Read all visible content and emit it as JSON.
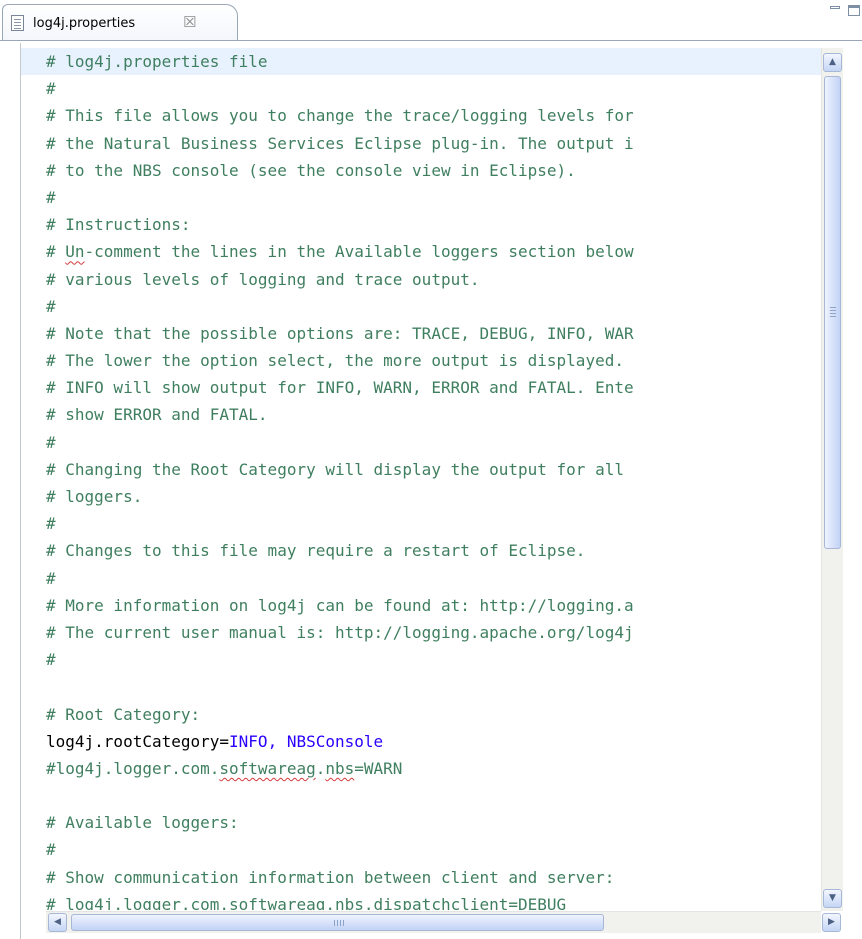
{
  "tab": {
    "title": "log4j.properties",
    "icon": "properties-file-icon",
    "close_glyph": "☒"
  },
  "window_controls": {
    "minimize_icon": "minimize-icon",
    "maximize_icon": "maximize-icon"
  },
  "editor": {
    "colors": {
      "comment": "#3f7f5f",
      "key": "#000000",
      "value": "#2a00ff",
      "current_line": "#e8f2fe"
    },
    "lines": [
      [
        {
          "t": "# log4j.properties file",
          "c": "c"
        }
      ],
      [
        {
          "t": "#",
          "c": "c"
        }
      ],
      [
        {
          "t": "# This file allows you to change the trace/logging levels for",
          "c": "c"
        }
      ],
      [
        {
          "t": "# the Natural Business Services Eclipse plug-in. The output i",
          "c": "c"
        }
      ],
      [
        {
          "t": "# to the NBS console (see the console view in Eclipse).",
          "c": "c"
        }
      ],
      [
        {
          "t": "#",
          "c": "c"
        }
      ],
      [
        {
          "t": "# Instructions:",
          "c": "c"
        }
      ],
      [
        {
          "t": "# ",
          "c": "c"
        },
        {
          "t": "Un",
          "c": "c",
          "sq": true
        },
        {
          "t": "-comment the lines in the Available loggers section below",
          "c": "c"
        }
      ],
      [
        {
          "t": "# various levels of logging and trace output.",
          "c": "c"
        }
      ],
      [
        {
          "t": "#",
          "c": "c"
        }
      ],
      [
        {
          "t": "# Note that the possible options are: TRACE, DEBUG, INFO, WAR",
          "c": "c"
        }
      ],
      [
        {
          "t": "# The lower the option select, the more output is displayed.",
          "c": "c"
        }
      ],
      [
        {
          "t": "# INFO will show output for INFO, WARN, ERROR and FATAL. Ente",
          "c": "c"
        }
      ],
      [
        {
          "t": "# show ERROR and FATAL.",
          "c": "c"
        }
      ],
      [
        {
          "t": "#",
          "c": "c"
        }
      ],
      [
        {
          "t": "# Changing the Root Category will display the output for all",
          "c": "c"
        }
      ],
      [
        {
          "t": "# loggers.",
          "c": "c"
        }
      ],
      [
        {
          "t": "#",
          "c": "c"
        }
      ],
      [
        {
          "t": "# Changes to this file may require a restart of Eclipse.",
          "c": "c"
        }
      ],
      [
        {
          "t": "#",
          "c": "c"
        }
      ],
      [
        {
          "t": "# More information on log4j can be found at: http://logging.a",
          "c": "c"
        }
      ],
      [
        {
          "t": "# The current user manual is: http://logging.apache.org/log4j",
          "c": "c"
        }
      ],
      [
        {
          "t": "#",
          "c": "c"
        }
      ],
      [
        {
          "t": "",
          "c": "c"
        }
      ],
      [
        {
          "t": "# Root Category:",
          "c": "c"
        }
      ],
      [
        {
          "t": "log4j.rootCategory",
          "c": "k"
        },
        {
          "t": "=",
          "c": "k"
        },
        {
          "t": "INFO, NBSConsole",
          "c": "v"
        }
      ],
      [
        {
          "t": "#log4j.logger.com.",
          "c": "c"
        },
        {
          "t": "softwareag",
          "c": "c",
          "sq": true
        },
        {
          "t": ".",
          "c": "c"
        },
        {
          "t": "nbs",
          "c": "c",
          "sq": true
        },
        {
          "t": "=WARN",
          "c": "c"
        }
      ],
      [
        {
          "t": "",
          "c": "c"
        }
      ],
      [
        {
          "t": "# Available loggers:",
          "c": "c"
        }
      ],
      [
        {
          "t": "#",
          "c": "c"
        }
      ],
      [
        {
          "t": "# Show communication information between client and server:",
          "c": "c"
        }
      ],
      [
        {
          "t": "# log4j.logger.com.softwareag.nbs.dispatchclient=DEBUG",
          "c": "c"
        }
      ]
    ]
  },
  "scrollbars": {
    "up_glyph": "▲",
    "down_glyph": "▼",
    "left_glyph": "◀",
    "right_glyph": "▶",
    "vertical_position": 0.0,
    "horizontal_position": 0.0
  }
}
